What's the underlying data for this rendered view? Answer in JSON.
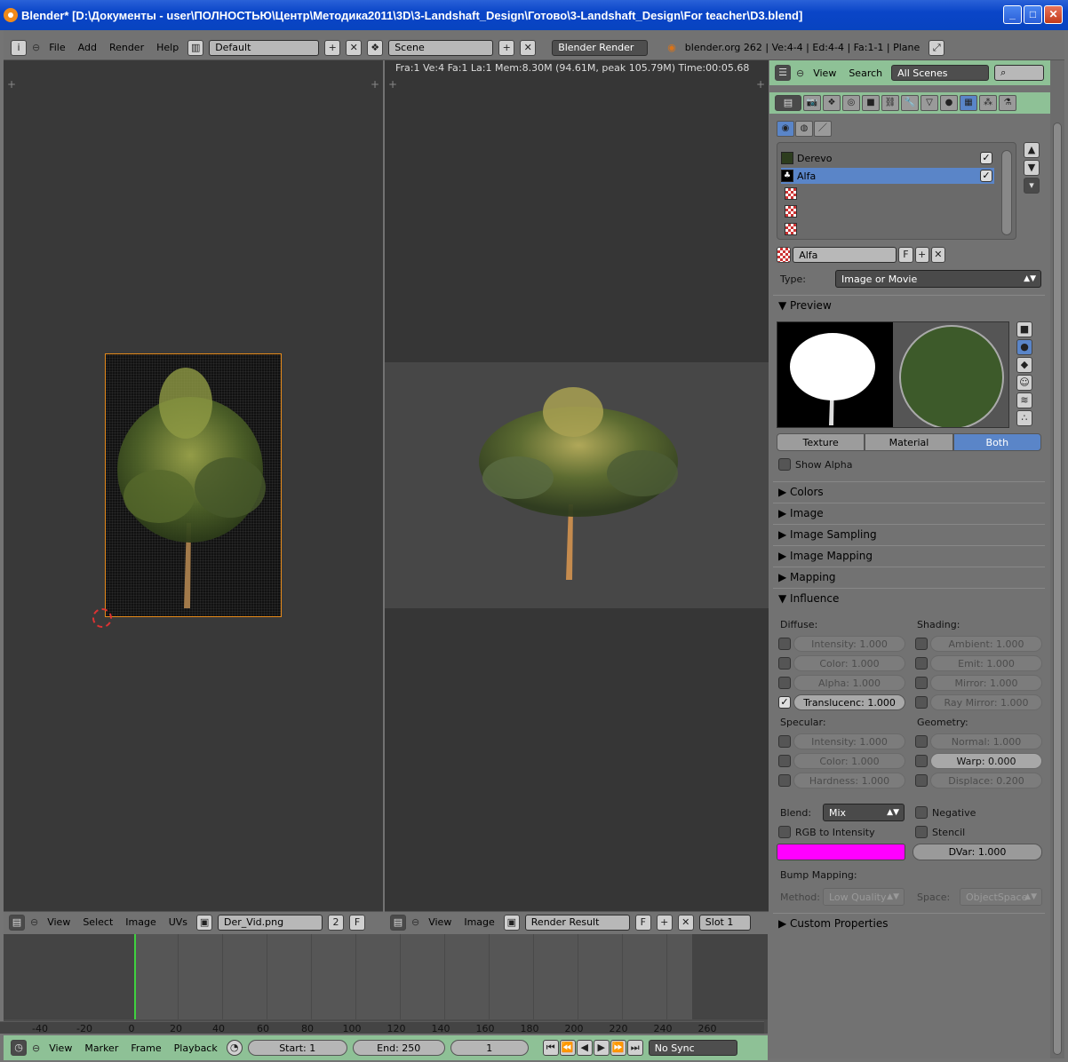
{
  "window": {
    "title": "Blender* [D:\\Документы - user\\ПОЛНОСТЬЮ\\Центр\\Методика2011\\3D\\3-Landshaft_Design\\Готово\\3-Landshaft_Design\\For teacher\\D3.blend]",
    "minimize": "_",
    "maximize": "□",
    "close": "✕"
  },
  "topbar": {
    "menus": [
      "File",
      "Add",
      "Render",
      "Help"
    ],
    "screen_layout": "Default",
    "scene": "Scene",
    "engine": "Blender Render",
    "stats": "blender.org 262 | Ve:4-4 | Ed:4-4 | Fa:1-1 | Plane"
  },
  "uv_editor": {
    "menus": [
      "View",
      "Select",
      "Image",
      "UVs"
    ],
    "image_name": "Der_Vid.png",
    "users": "2",
    "fake": "F"
  },
  "render_view": {
    "stats": "Fra:1  Ve:4 Fa:1 La:1 Mem:8.30M (94.61M, peak 105.79M) Time:00:05.68",
    "menus": [
      "View",
      "Image"
    ],
    "image_name": "Render Result",
    "fake": "F",
    "slot": "Slot 1"
  },
  "timeline": {
    "ticks": [
      "-40",
      "-20",
      "0",
      "20",
      "40",
      "60",
      "80",
      "100",
      "120",
      "140",
      "160",
      "180",
      "200",
      "220",
      "240",
      "260"
    ],
    "menus": [
      "View",
      "Marker",
      "Frame",
      "Playback"
    ],
    "start": "Start: 1",
    "end": "End: 250",
    "current": "1",
    "sync": "No Sync",
    "current_frame_color": "#3fd13f"
  },
  "properties": {
    "outliner_menus": [
      "View",
      "Search"
    ],
    "outliner_filter": "All Scenes",
    "texture_slots": [
      "Derevo",
      "Alfa"
    ],
    "texture_name": "Alfa",
    "fake": "F",
    "type_label": "Type:",
    "type_value": "Image or Movie",
    "preview_header": "Preview",
    "preview_tabs": [
      "Texture",
      "Material",
      "Both"
    ],
    "show_alpha": "Show Alpha",
    "collapsed_panels": [
      "Colors",
      "Image",
      "Image Sampling",
      "Image Mapping",
      "Mapping"
    ],
    "influence_header": "Influence",
    "diffuse_label": "Diffuse:",
    "shading_label": "Shading:",
    "diffuse": [
      "Intensity: 1.000",
      "Color: 1.000",
      "Alpha: 1.000",
      "Translucenc: 1.000"
    ],
    "shading": [
      "Ambient: 1.000",
      "Emit: 1.000",
      "Mirror: 1.000",
      "Ray Mirror: 1.000"
    ],
    "specular_label": "Specular:",
    "geometry_label": "Geometry:",
    "specular": [
      "Intensity: 1.000",
      "Color: 1.000",
      "Hardness: 1.000"
    ],
    "geometry": [
      "Normal: 1.000",
      "Warp: 0.000",
      "Displace: 0.200"
    ],
    "blend_label": "Blend:",
    "blend_value": "Mix",
    "negative": "Negative",
    "rgb_to_intensity": "RGB to Intensity",
    "stencil": "Stencil",
    "color_swatch": "#ff00ff",
    "dvar": "DVar: 1.000",
    "bump_label": "Bump Mapping:",
    "method_label": "Method:",
    "method_value": "Low Quality",
    "space_label": "Space:",
    "space_value": "ObjectSpace",
    "custom_properties": "Custom Properties",
    "accent_color": "#5a85c8"
  }
}
